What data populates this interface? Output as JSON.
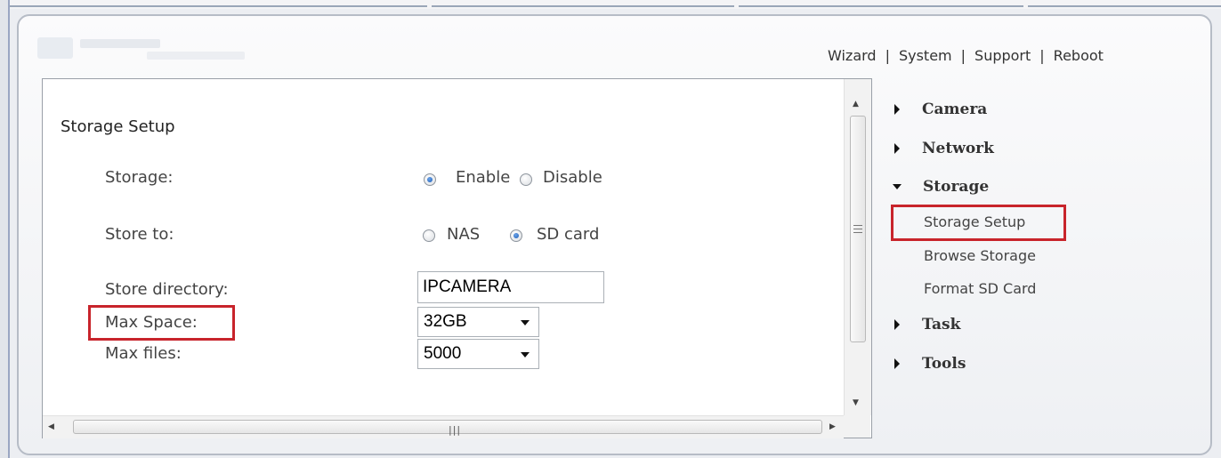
{
  "topnav": {
    "wizard": "Wizard",
    "system": "System",
    "support": "Support",
    "reboot": "Reboot",
    "separator": "|"
  },
  "form": {
    "title": "Storage Setup",
    "storage": {
      "label": "Storage:",
      "options": [
        "Enable",
        "Disable"
      ],
      "selected": "Enable"
    },
    "store_to": {
      "label": "Store to:",
      "options": [
        "NAS",
        "SD card"
      ],
      "selected": "SD card"
    },
    "store_directory": {
      "label": "Store directory:",
      "value": "IPCAMERA"
    },
    "max_space": {
      "label": "Max Space:",
      "value": "32GB"
    },
    "max_files": {
      "label": "Max files:",
      "value": "5000"
    }
  },
  "sidebar": {
    "items": [
      {
        "label": "Camera",
        "expanded": false
      },
      {
        "label": "Network",
        "expanded": false
      },
      {
        "label": "Storage",
        "expanded": true,
        "children": [
          "Storage Setup",
          "Browse Storage",
          "Format SD Card"
        ],
        "active_child": "Storage Setup"
      },
      {
        "label": "Task",
        "expanded": false
      },
      {
        "label": "Tools",
        "expanded": false
      }
    ]
  },
  "highlight_color": "#c8242b",
  "radio_color": "#1f5fb7"
}
